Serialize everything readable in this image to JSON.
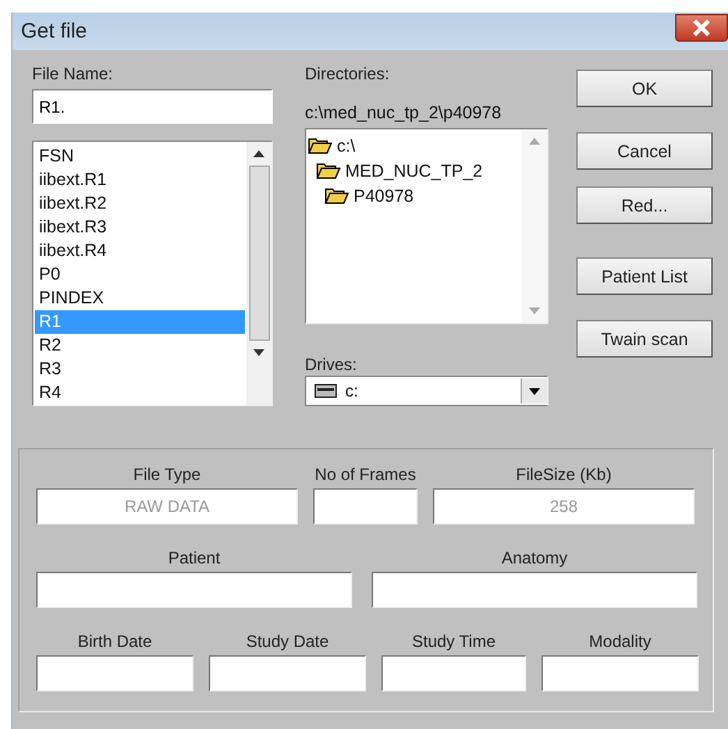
{
  "window": {
    "title": "Get file"
  },
  "file_name": {
    "label": "File Name:",
    "value": "R1."
  },
  "files": [
    {
      "name": "FSN",
      "selected": false
    },
    {
      "name": "iibext.R1",
      "selected": false
    },
    {
      "name": "iibext.R2",
      "selected": false
    },
    {
      "name": "iibext.R3",
      "selected": false
    },
    {
      "name": "iibext.R4",
      "selected": false
    },
    {
      "name": "P0",
      "selected": false
    },
    {
      "name": "PINDEX",
      "selected": false
    },
    {
      "name": "R1",
      "selected": true
    },
    {
      "name": "R2",
      "selected": false
    },
    {
      "name": "R3",
      "selected": false
    },
    {
      "name": "R4",
      "selected": false
    }
  ],
  "directories": {
    "label": "Directories:",
    "path": "c:\\med_nuc_tp_2\\p40978",
    "tree": [
      {
        "name": "c:\\",
        "children": [
          {
            "name": "MED_NUC_TP_2",
            "children": [
              {
                "name": "P40978"
              }
            ]
          }
        ]
      }
    ]
  },
  "drives": {
    "label": "Drives:",
    "value": "c:"
  },
  "buttons": [
    "OK",
    "Cancel",
    "Red...",
    "Patient List",
    "Twain scan"
  ],
  "info_rows": [
    [
      {
        "label": "File Type",
        "value": "RAW DATA"
      },
      {
        "label": "No of Frames"
      },
      {
        "label": "FileSize (Kb)",
        "value": "258"
      }
    ],
    [
      {
        "label": "Patient"
      },
      {
        "label": "Anatomy"
      }
    ],
    [
      {
        "label": "Birth Date"
      },
      {
        "label": "Study Date"
      },
      {
        "label": "Study Time"
      },
      {
        "label": "Modality"
      }
    ]
  ]
}
